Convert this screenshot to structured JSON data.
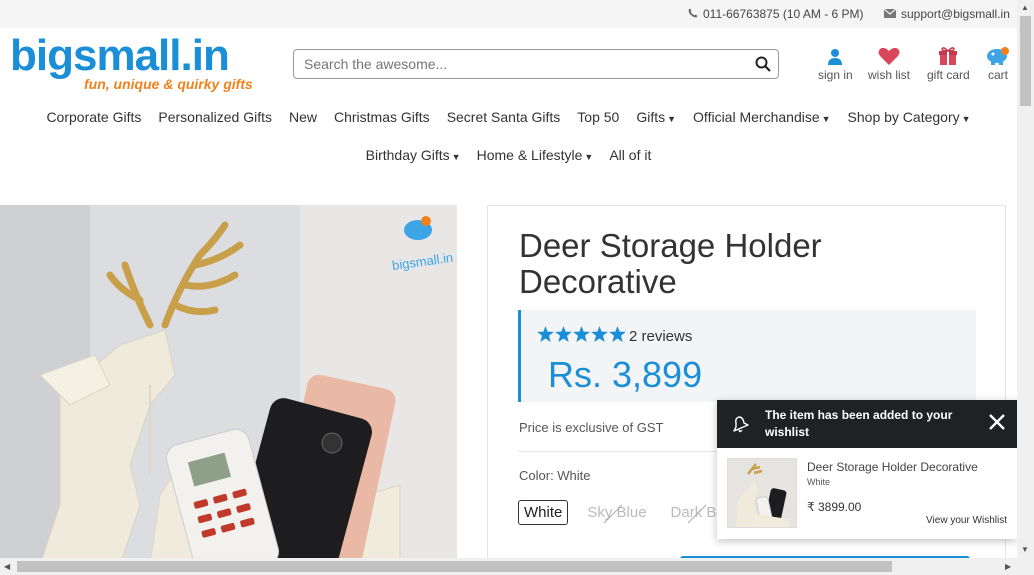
{
  "topbar": {
    "phone": "011-66763875 (10 AM - 6 PM)",
    "email": "support@bigsmall.in"
  },
  "logo": {
    "name": "bigsmall.in",
    "tagline": "fun, unique & quirky gifts"
  },
  "search": {
    "placeholder": "Search the awesome..."
  },
  "header_icons": [
    {
      "label": "sign in",
      "icon": "user-icon"
    },
    {
      "label": "wish list",
      "icon": "heart-icon"
    },
    {
      "label": "gift card",
      "icon": "gift-icon"
    },
    {
      "label": "cart",
      "icon": "cart-icon"
    }
  ],
  "nav_row1": [
    "Corporate Gifts",
    "Personalized Gifts",
    "New",
    "Christmas Gifts",
    "Secret Santa Gifts",
    "Top 50",
    "Gifts",
    "Official Merchandise",
    "Shop by Category"
  ],
  "nav_row2": [
    "Birthday Gifts",
    "Home & Lifestyle",
    "All of it"
  ],
  "product": {
    "title": "Deer Storage Holder Decorative",
    "rating": 5,
    "reviews": "2 reviews",
    "price": "Rs. 3,899",
    "gst_note": "Price is exclusive of GST",
    "color_label": "Color: White",
    "variants": [
      "White",
      "Sky Blue",
      "Dark Blue"
    ],
    "selected_variant": "White",
    "watermark": "bigsmall.in"
  },
  "toast": {
    "message": "The item has been added to your wishlist",
    "item_name": "Deer Storage Holder Decorative",
    "item_color": "White",
    "item_price": "₹ 3899.00",
    "link": "View your Wishlist"
  },
  "colors": {
    "brand_blue": "#1a8fd8",
    "brand_orange": "#f0821e",
    "toast_header": "#1f2224"
  }
}
